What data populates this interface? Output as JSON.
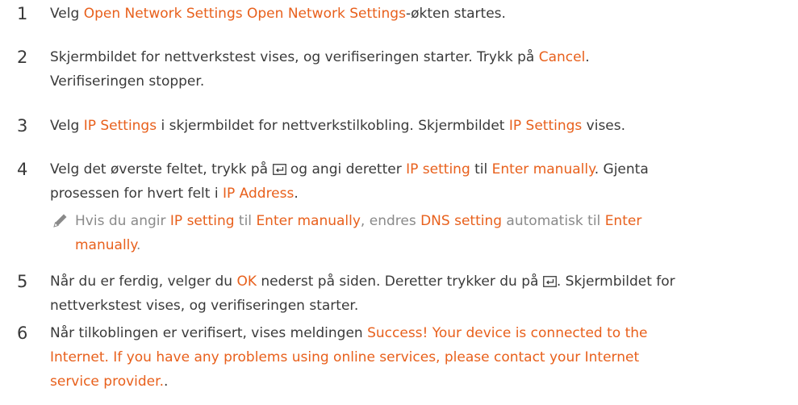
{
  "steps": [
    {
      "num": "1",
      "segments": [
        {
          "t": "Velg ",
          "h": false
        },
        {
          "t": "Open Network Settings Open Network Settings",
          "h": true
        },
        {
          "t": "-økten startes.",
          "h": false
        }
      ]
    },
    {
      "num": "2",
      "segments": [
        {
          "t": "Skjermbildet for nettverkstest vises, og verifiseringen starter. Trykk på ",
          "h": false
        },
        {
          "t": "Cancel",
          "h": true
        },
        {
          "t": ".",
          "h": false
        },
        {
          "br": true
        },
        {
          "t": "Verifiseringen stopper.",
          "h": false
        }
      ]
    },
    {
      "num": "3",
      "segments": [
        {
          "t": "Velg ",
          "h": false
        },
        {
          "t": "IP Settings",
          "h": true
        },
        {
          "t": " i skjermbildet for nettverkstilkobling. Skjermbildet ",
          "h": false
        },
        {
          "t": "IP Settings",
          "h": true
        },
        {
          "t": " vises.",
          "h": false
        }
      ]
    },
    {
      "num": "4",
      "segments": [
        {
          "t": "Velg det øverste feltet, trykk på ",
          "h": false
        },
        {
          "icon": "enter-key-icon"
        },
        {
          "t": " og angi deretter ",
          "h": false
        },
        {
          "t": "IP setting",
          "h": true
        },
        {
          "t": " til ",
          "h": false
        },
        {
          "t": "Enter manually",
          "h": true
        },
        {
          "t": ". Gjenta",
          "h": false
        },
        {
          "br": true
        },
        {
          "t": "prosessen for hvert felt i ",
          "h": false
        },
        {
          "t": "IP Address",
          "h": true
        },
        {
          "t": ".",
          "h": false
        }
      ]
    },
    {
      "num": "5",
      "segments": [
        {
          "t": "Når du er ferdig, velger du ",
          "h": false
        },
        {
          "t": "OK",
          "h": true
        },
        {
          "t": " nederst på siden. Deretter trykker du på ",
          "h": false
        },
        {
          "icon": "enter-key-icon"
        },
        {
          "t": ". Skjermbildet for",
          "h": false
        },
        {
          "br": true
        },
        {
          "t": "nettverkstest vises, og verifiseringen starter.",
          "h": false
        }
      ]
    },
    {
      "num": "6",
      "segments": [
        {
          "t": "Når tilkoblingen er verifisert, vises meldingen ",
          "h": false
        },
        {
          "t": "Success! Your device is connected to the",
          "h": true
        },
        {
          "br": true
        },
        {
          "t": "Internet. If you have any problems using online services, please contact your Internet",
          "h": true
        },
        {
          "br": true
        },
        {
          "t": "service provider.",
          "h": true
        },
        {
          "t": ".",
          "h": false
        }
      ]
    }
  ],
  "note": {
    "icon": "pencil-icon",
    "segments": [
      {
        "t": "Hvis du angir ",
        "h": false
      },
      {
        "t": "IP setting",
        "h": true
      },
      {
        "t": " til ",
        "h": false
      },
      {
        "t": "Enter manually",
        "h": true
      },
      {
        "t": ", endres ",
        "h": false
      },
      {
        "t": "DNS setting",
        "h": true
      },
      {
        "t": " automatisk til ",
        "h": false
      },
      {
        "t": "Enter",
        "h": true
      },
      {
        "br": true
      },
      {
        "t": "manually",
        "h": true
      },
      {
        "t": ".",
        "h": false
      }
    ]
  }
}
